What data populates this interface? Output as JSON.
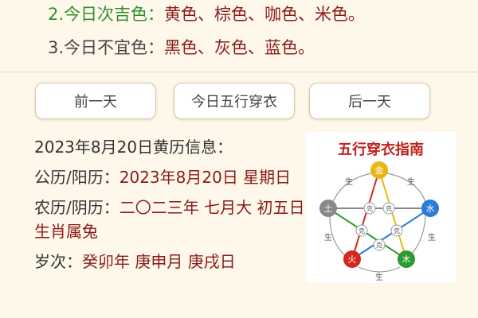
{
  "colors": {
    "lucky": {
      "label": "2.今日次吉色：",
      "value": "黄色、棕色、咖色、米色。"
    },
    "unlucky": {
      "label": "3.今日不宜色：",
      "value": "黑色、灰色、蓝色。"
    }
  },
  "nav": {
    "prev": "前一天",
    "today": "今日五行穿衣",
    "next": "后一天"
  },
  "info": {
    "title": "2023年8月20日黄历信息：",
    "gregorian_label": "公历/阳历：",
    "gregorian_value": "2023年8月20日 星期日",
    "lunar_label": "农历/阴历：",
    "lunar_value": "二〇二三年 七月大 初五日 生肖属兔",
    "ganzhi_label": "岁次：",
    "ganzhi_value": "癸卯年 庚申月 庚戌日"
  },
  "guide": {
    "title": "五行穿衣指南",
    "elements": {
      "top": "金",
      "right": "水",
      "left": "土",
      "bottom_left": "火",
      "bottom_right": "木"
    },
    "sheng": "生",
    "ke": "克",
    "element_colors": {
      "top": "#e9b714",
      "right": "#2a7ad8",
      "left": "#888888",
      "bottom_left": "#d9261c",
      "bottom_right": "#2e9a2e"
    }
  }
}
